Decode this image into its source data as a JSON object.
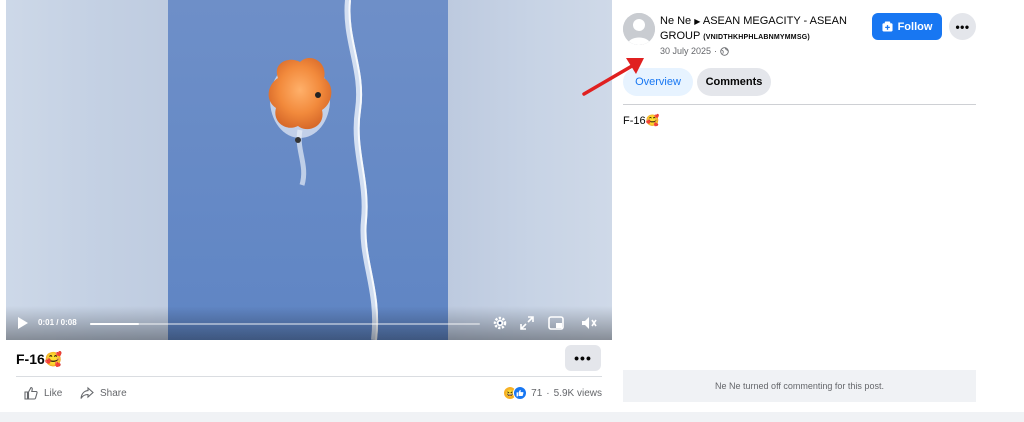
{
  "video": {
    "time_display": "0:01 / 0:08",
    "progress_fraction": 0.125
  },
  "post": {
    "title": "F-16🥰",
    "more_label": "•••"
  },
  "actions": {
    "like_label": "Like",
    "share_label": "Share"
  },
  "stats": {
    "reaction_count": "71",
    "separator": "·",
    "views": "5.9K views"
  },
  "author": {
    "name": "Ne Ne",
    "group": "ASEAN MEGACITY - ASEAN GROUP",
    "group_tag": "(VNIDTHKHPHLABNMYMMSG)",
    "date": "30 July 2025",
    "separator": "·"
  },
  "header": {
    "follow_label": "Follow",
    "more_label": "•••"
  },
  "tabs": [
    {
      "label": "Overview",
      "active": true
    },
    {
      "label": "Comments",
      "active": false
    }
  ],
  "description": "F-16🥰",
  "comments_notice": "Ne Ne turned off commenting for this post.",
  "colors": {
    "accent": "#1877f2",
    "annotation_arrow": "#e02020"
  }
}
